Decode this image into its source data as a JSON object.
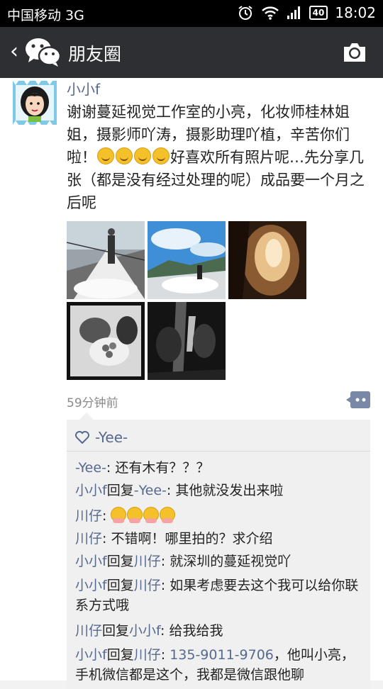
{
  "status_bar": {
    "carrier": "中国移动 3G",
    "battery": "40",
    "time": "18:02"
  },
  "header": {
    "title": "朋友圈"
  },
  "post": {
    "username": "小小f",
    "text_1": "谢谢蔓延视觉工作室的小亮，化妆师桂林姐姐，摄影师吖涛，摄影助理吖植，辛苦你们啦！",
    "text_2": "好喜欢所有照片呢…先分享几张（都是没有经过处理的呢）成品要一个月之后呢",
    "emoji_count": 4,
    "photos": [
      "wedding-yacht-deck",
      "wedding-sky-sea",
      "veil-backlit",
      "bouquet-couple",
      "couple-silhouette"
    ],
    "time_ago": "59分钟前"
  },
  "likes": {
    "names": "-Yee-"
  },
  "comments": [
    {
      "name": "-Yee-",
      "reply_word": "",
      "target": "",
      "sep": ": ",
      "text": "还有木有？？？",
      "hugs": 0
    },
    {
      "name": "小小f",
      "reply_word": "回复",
      "target": "-Yee-",
      "sep": ": ",
      "text": "其他就没发出来啦",
      "hugs": 0
    },
    {
      "name": "川仔",
      "reply_word": "",
      "target": "",
      "sep": ": ",
      "text": "",
      "hugs": 4
    },
    {
      "name": "川仔",
      "reply_word": "",
      "target": "",
      "sep": ": ",
      "text": "不错啊！哪里拍的？求介绍",
      "hugs": 0
    },
    {
      "name": "小小f",
      "reply_word": "回复",
      "target": "川仔",
      "sep": ": ",
      "text": "就深圳的蔓延视觉吖",
      "hugs": 0
    },
    {
      "name": "小小f",
      "reply_word": "回复",
      "target": "川仔",
      "sep": ": ",
      "text": "如果考虑要去这个我可以给你联系方式哦",
      "hugs": 0
    },
    {
      "name": "川仔",
      "reply_word": "回复",
      "target": "小小f",
      "sep": ": ",
      "text": "给我给我",
      "hugs": 0
    },
    {
      "name": "小小f",
      "reply_word": "回复",
      "target": "川仔",
      "sep": ": ",
      "phone": "135-9011-9706",
      "text": "，他叫小亮，手机微信都是这个，我都是微信跟他聊",
      "hugs": 0
    }
  ],
  "colors": {
    "name_link": "#56698f",
    "header_bg": "#2d2f33",
    "wechat_green": "#45c01a"
  }
}
